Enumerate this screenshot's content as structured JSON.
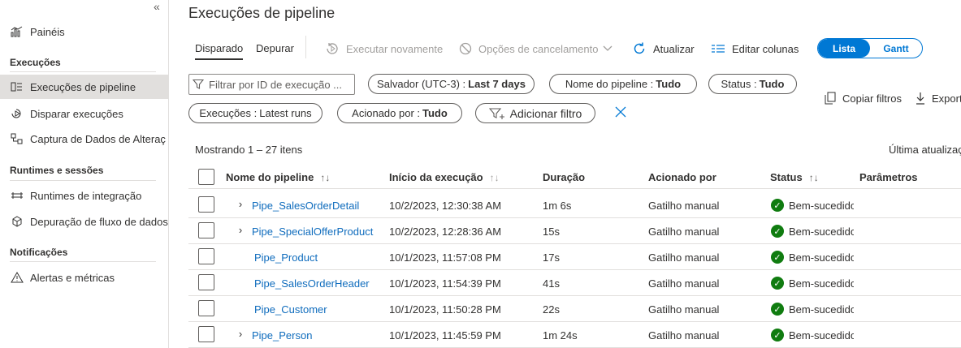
{
  "sidebar": {
    "collapse_icon": "«",
    "dashboards_label": "Painéis",
    "section_runs": "Execuções",
    "pipeline_runs_label": "Execuções de pipeline",
    "trigger_runs_label": "Disparar execuções",
    "cdc_label": "Captura de Dados de Alteraç",
    "section_runtimes": "Runtimes e sessões",
    "integration_runtimes_label": "Runtimes de integração",
    "dataflow_debug_label": "Depuração de fluxo de dados",
    "section_notifications": "Notificações",
    "alerts_label": "Alertas e métricas"
  },
  "header": {
    "title": "Execuções de pipeline"
  },
  "toolbar": {
    "tab_triggered": "Disparado",
    "tab_debug": "Depurar",
    "rerun_label": "Executar novamente",
    "cancel_options_label": "Opções de cancelamento",
    "refresh_label": "Atualizar",
    "edit_columns_label": "Editar colunas",
    "view_list": "Lista",
    "view_gantt": "Gantt"
  },
  "filters": {
    "search_placeholder": "Filtrar por ID de execução ...",
    "timezone_label": "Salvador (UTC-3) :",
    "timezone_value": "Last 7 days",
    "pipeline_name_label": "Nome do pipeline :",
    "pipeline_name_value": "Tudo",
    "status_label": "Status :",
    "status_value": "Tudo",
    "runs_label": "Execuções :",
    "runs_value": "Latest runs",
    "triggered_by_label": "Acionado por :",
    "triggered_by_value": "Tudo",
    "add_filter_label": "Adicionar filtro",
    "copy_filters_label": "Copiar filtros",
    "export_label": "Export"
  },
  "summary": {
    "showing": "Mostrando 1 – 27 itens",
    "last_updated": "Última atualizaç"
  },
  "table": {
    "columns": {
      "name": "Nome do pipeline",
      "start": "Início da execução",
      "duration": "Duração",
      "triggered_by": "Acionado por",
      "status": "Status",
      "parameters": "Parâmetros"
    },
    "sort_icon": "↑↓",
    "rows": [
      {
        "name": "Pipe_SalesOrderDetail",
        "start": "10/2/2023, 12:30:38 AM",
        "duration": "1m 6s",
        "triggered_by": "Gatilho manual",
        "status": "Bem-sucedido",
        "expandable": "›"
      },
      {
        "name": "Pipe_SpecialOfferProduct",
        "start": "10/2/2023, 12:28:36 AM",
        "duration": "15s",
        "triggered_by": "Gatilho manual",
        "status": "Bem-sucedido",
        "expandable": "›"
      },
      {
        "name": "Pipe_Product",
        "start": "10/1/2023, 11:57:08 PM",
        "duration": "17s",
        "triggered_by": "Gatilho manual",
        "status": "Bem-sucedido",
        "expandable": ""
      },
      {
        "name": "Pipe_SalesOrderHeader",
        "start": "10/1/2023, 11:54:39 PM",
        "duration": "41s",
        "triggered_by": "Gatilho manual",
        "status": "Bem-sucedido",
        "expandable": ""
      },
      {
        "name": "Pipe_Customer",
        "start": "10/1/2023, 11:50:28 PM",
        "duration": "22s",
        "triggered_by": "Gatilho manual",
        "status": "Bem-sucedido",
        "expandable": ""
      },
      {
        "name": "Pipe_Person",
        "start": "10/1/2023, 11:45:59 PM",
        "duration": "1m 24s",
        "triggered_by": "Gatilho manual",
        "status": "Bem-sucedido",
        "expandable": "›"
      }
    ]
  },
  "colors": {
    "accent": "#0078d4",
    "link": "#0f6cbd",
    "success": "#107c10",
    "selected_nav": "#e1dfdd"
  }
}
